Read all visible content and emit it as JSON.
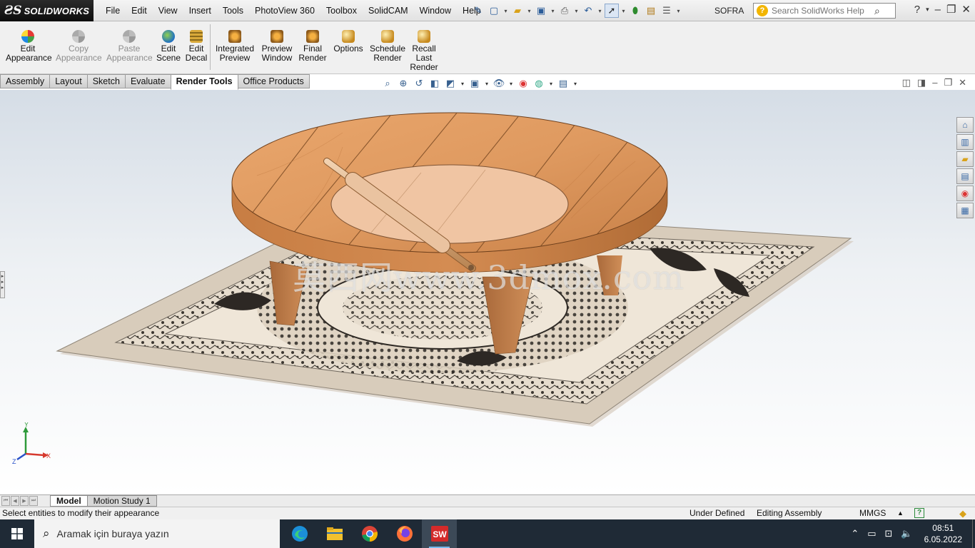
{
  "app": {
    "logo_ds": "ƧS",
    "logo_text": "SOLIDWORKS",
    "document_name": "SOFRA"
  },
  "menu": [
    "File",
    "Edit",
    "View",
    "Insert",
    "Tools",
    "PhotoView 360",
    "Toolbox",
    "SolidCAM",
    "Window",
    "Help"
  ],
  "search": {
    "placeholder": "Search SolidWorks Help"
  },
  "commands": {
    "edit_appearance": [
      "Edit",
      "Appearance"
    ],
    "copy_appearance": [
      "Copy",
      "Appearance"
    ],
    "paste_appearance": [
      "Paste",
      "Appearance"
    ],
    "edit_scene": [
      "Edit",
      "Scene"
    ],
    "edit_decal": [
      "Edit",
      "Decal"
    ],
    "integrated_preview": [
      "Integrated",
      "Preview"
    ],
    "preview_window": [
      "Preview",
      "Window"
    ],
    "final_render": [
      "Final",
      "Render"
    ],
    "options": [
      "Options"
    ],
    "schedule_render": [
      "Schedule",
      "Render"
    ],
    "recall_last_render": [
      "Recall",
      "Last",
      "Render"
    ]
  },
  "tabs": [
    "Assembly",
    "Layout",
    "Sketch",
    "Evaluate",
    "Render Tools",
    "Office Products"
  ],
  "active_tab": "Render Tools",
  "watermark": "莫西网www.3dmox.com",
  "triad": {
    "x": "X",
    "y": "Y",
    "z": "Z"
  },
  "bottom_tabs": {
    "model": "Model",
    "motion_study": "Motion Study 1"
  },
  "status": {
    "message": "Select entities to modify their appearance",
    "definition": "Under Defined",
    "mode": "Editing Assembly",
    "units": "MMGS"
  },
  "taskbar": {
    "search_placeholder": "Aramak için buraya yazın",
    "time": "08:51",
    "date": "6.05.2022"
  },
  "colors": {
    "wood_light": "#e9a66c",
    "wood_dark": "#b8703d",
    "dough": "#f0c5a3",
    "rug": "#e8ddcd",
    "accent": "#2a5c99"
  }
}
